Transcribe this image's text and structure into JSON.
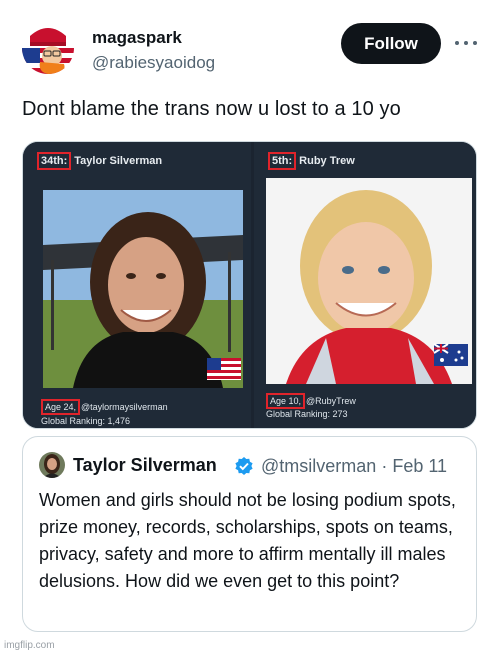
{
  "post": {
    "author_name": "magaspark",
    "author_handle": "@rabiesyaoidog",
    "follow_label": "Follow",
    "text": "Dont blame the trans now u lost to a 10 yo"
  },
  "media": {
    "left": {
      "rank": "34th:",
      "name": "Taylor Silverman",
      "age": "Age 24,",
      "handle": "@taylormaysilverman",
      "ranking": "Global Ranking: 1,476"
    },
    "right": {
      "rank": "5th:",
      "name": "Ruby Trew",
      "age": "Age 10,",
      "handle": "@RubyTrew",
      "ranking": "Global Ranking: 273"
    }
  },
  "quote": {
    "author_name": "Taylor Silverman",
    "author_handle": "@tmsilverman",
    "separator": "·",
    "date": "Feb 11",
    "text": "Women and girls should not be losing podium spots, prize money, records, scholarships, spots on teams, privacy, safety and more to affirm mentally ill males delusions. How did we even get to this point?"
  },
  "watermark": "imgflip.com",
  "colors": {
    "accent": "#1d9bf0",
    "follow_bg": "#0f1419",
    "highlight_box": "#e0242b"
  }
}
